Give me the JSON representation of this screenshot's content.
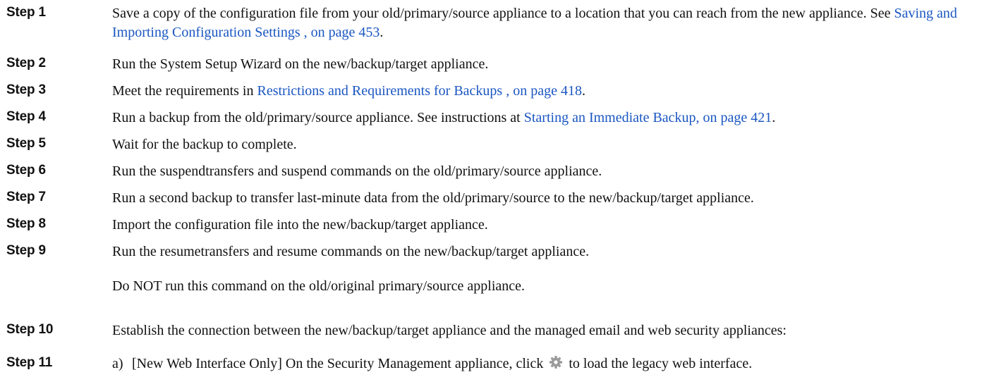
{
  "steps": [
    {
      "label": "Step 1",
      "text_before": "Save a copy of the configuration file from your old/primary/source appliance to a location that you can reach from the new appliance. See ",
      "link": "Saving and Importing Configuration Settings , on page 453",
      "text_after": "."
    },
    {
      "label": "Step 2",
      "text": "Run the System Setup Wizard on the new/backup/target appliance."
    },
    {
      "label": "Step 3",
      "text_before": "Meet the requirements in ",
      "link": "Restrictions and Requirements for Backups , on page 418",
      "text_after": "."
    },
    {
      "label": "Step 4",
      "text_before": "Run a backup from the old/primary/source appliance. See instructions at ",
      "link": "Starting an Immediate Backup, on page 421",
      "text_after": "."
    },
    {
      "label": "Step 5",
      "text": "Wait for the backup to complete."
    },
    {
      "label": "Step 6",
      "text": "Run the suspendtransfers and suspend commands on the old/primary/source appliance."
    },
    {
      "label": "Step 7",
      "text": "Run a second backup to transfer last-minute data from the old/primary/source to the new/backup/target appliance."
    },
    {
      "label": "Step 8",
      "text": "Import the configuration file into the new/backup/target appliance."
    },
    {
      "label": "Step 9",
      "text": "Run the resumetransfers and resume commands on the new/backup/target appliance.",
      "note": "Do NOT run this command on the old/original primary/source appliance."
    },
    {
      "label": "Step 10",
      "text": "Establish the connection between the new/backup/target appliance and the managed email and web security appliances:"
    },
    {
      "label": "Step 11",
      "sub_letter": "a)",
      "text_before": "[New Web Interface Only] On the Security Management appliance, click ",
      "icon": "gear-icon",
      "text_after": " to load the legacy web interface."
    }
  ],
  "colors": {
    "link": "#1a56c2",
    "text": "#111111",
    "icon": "#9a9a9a"
  }
}
